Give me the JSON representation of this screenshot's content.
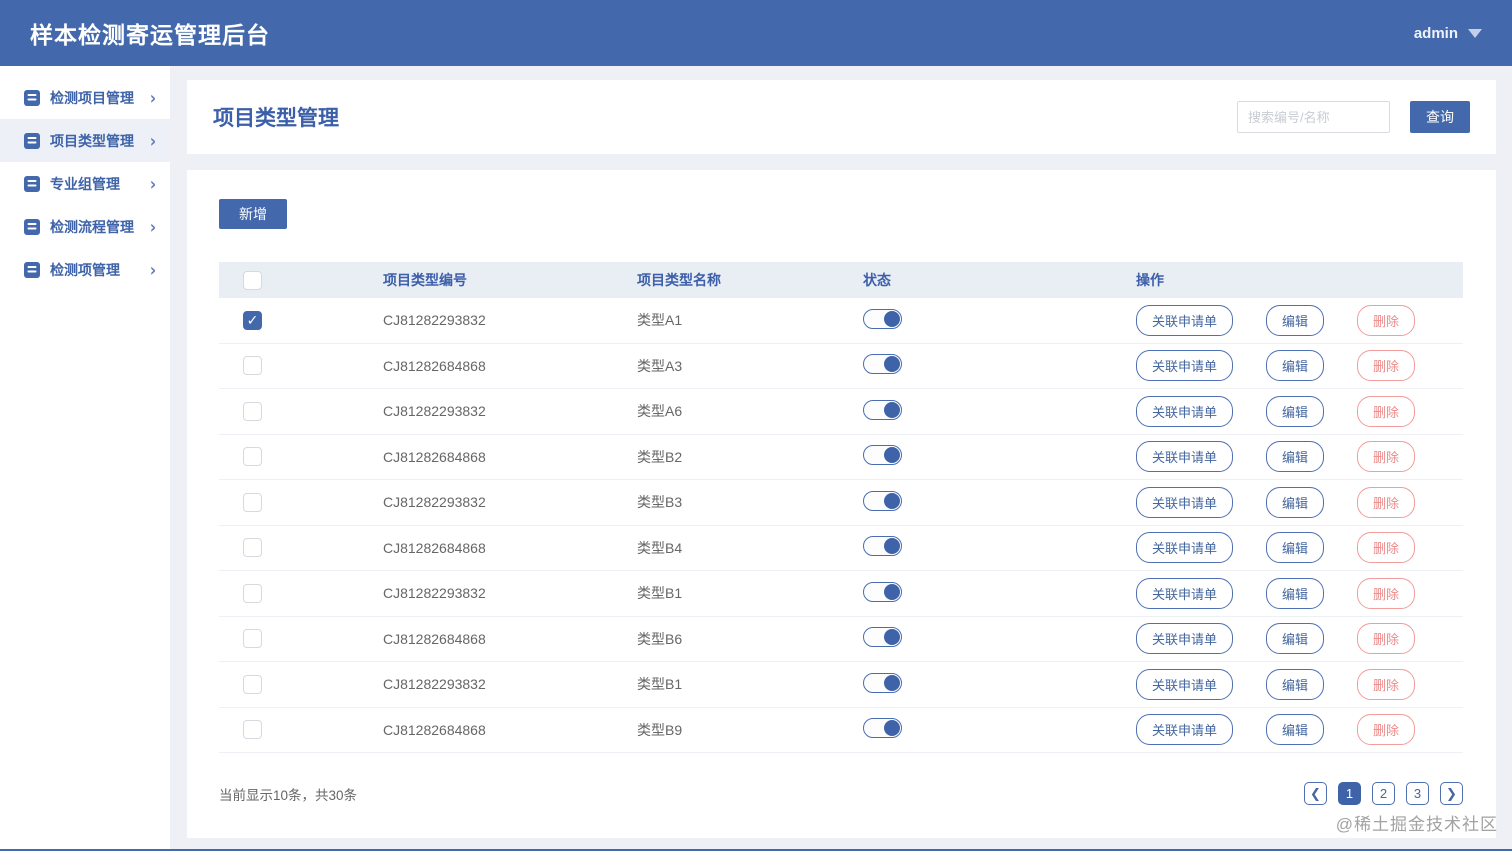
{
  "header": {
    "title": "样本检测寄运管理后台",
    "user": "admin"
  },
  "sidebar": {
    "items": [
      {
        "label": "检测项目管理",
        "active": false
      },
      {
        "label": "项目类型管理",
        "active": true
      },
      {
        "label": "专业组管理",
        "active": false
      },
      {
        "label": "检测流程管理",
        "active": false
      },
      {
        "label": "检测项管理",
        "active": false
      }
    ],
    "chevron": "›"
  },
  "page": {
    "title": "项目类型管理",
    "search_placeholder": "搜索编号/名称",
    "search_button": "查询",
    "add_button": "新增"
  },
  "table": {
    "columns": [
      "项目类型编号",
      "项目类型名称",
      "状态",
      "操作"
    ],
    "actions": {
      "relate": "关联申请单",
      "edit": "编辑",
      "delete": "删除"
    },
    "check_glyph": "✓",
    "rows": [
      {
        "code": "CJ81282293832",
        "name": "类型A1",
        "checked": true,
        "status_on": true
      },
      {
        "code": "CJ81282684868",
        "name": "类型A3",
        "checked": false,
        "status_on": true
      },
      {
        "code": "CJ81282293832",
        "name": "类型A6",
        "checked": false,
        "status_on": true
      },
      {
        "code": "CJ81282684868",
        "name": "类型B2",
        "checked": false,
        "status_on": true
      },
      {
        "code": "CJ81282293832",
        "name": "类型B3",
        "checked": false,
        "status_on": true
      },
      {
        "code": "CJ81282684868",
        "name": "类型B4",
        "checked": false,
        "status_on": true
      },
      {
        "code": "CJ81282293832",
        "name": "类型B1",
        "checked": false,
        "status_on": true
      },
      {
        "code": "CJ81282684868",
        "name": "类型B6",
        "checked": false,
        "status_on": true
      },
      {
        "code": "CJ81282293832",
        "name": "类型B1",
        "checked": false,
        "status_on": true
      },
      {
        "code": "CJ81282684868",
        "name": "类型B9",
        "checked": false,
        "status_on": true
      }
    ]
  },
  "pagination": {
    "summary": "当前显示10条，共30条",
    "prev": "❮",
    "next": "❯",
    "pages": [
      "1",
      "2",
      "3"
    ],
    "active_page": "1"
  },
  "watermark": "@稀土掘金技术社区",
  "colors": {
    "header_bg": "#4368ac",
    "accent_blue": "#3f63a9",
    "delete_red": "#ec8a89"
  }
}
